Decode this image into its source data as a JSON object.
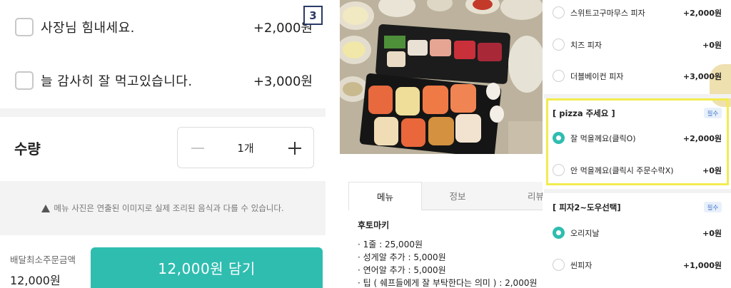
{
  "left": {
    "options": [
      {
        "label": "사장님 힘내세요.",
        "price": "+2,000원"
      },
      {
        "label": "늘 감사히 잘 먹고있습니다.",
        "price": "+3,000원"
      }
    ],
    "page_badge": "3",
    "quantity": {
      "label": "수량",
      "value": "1개"
    },
    "notice": "메뉴 사진은 연출된 이미지로 실제 조리된 음식과 다를 수 있습니다.",
    "min_order": {
      "label": "배달최소주문금액",
      "value": "12,000원"
    },
    "add_button": "12,000원 담기"
  },
  "middle": {
    "tabs": [
      "메뉴",
      "정보",
      "리뷰"
    ],
    "menu_title": "후토마키",
    "menu_lines": [
      "· 1줄 : 25,000원",
      "· 성게알 추가 : 5,000원",
      "· 연어알 추가 : 5,000원",
      "· 팁 ( 쉐프들에게 잘 부탁한다는 의미 ) : 2,000원"
    ]
  },
  "right": {
    "top_options": [
      {
        "label": "스위트고구마무스 피자",
        "price": "+2,000원"
      },
      {
        "label": "치즈 피자",
        "price": "+0원"
      },
      {
        "label": "더블베이컨 피자",
        "price": "+3,000원"
      }
    ],
    "group1": {
      "title": "[ pizza 주세요 ]",
      "badge": "필수",
      "options": [
        {
          "label": "잘 먹을께요(클릭O)",
          "price": "+2,000원",
          "selected": true
        },
        {
          "label": "안 먹을께요(클릭시 주문수락X)",
          "price": "+0원",
          "selected": false
        }
      ]
    },
    "group2": {
      "title": "[ 피자2~도우선택]",
      "badge": "필수",
      "options": [
        {
          "label": "오리지날",
          "price": "+0원",
          "selected": true
        },
        {
          "label": "씬피자",
          "price": "+1,000원",
          "selected": false
        }
      ]
    }
  },
  "colors": {
    "accent": "#2fbdb0",
    "highlight": "#f2ec4f",
    "badge_bg": "#e7f0fb",
    "badge_text": "#4a7ac9"
  }
}
